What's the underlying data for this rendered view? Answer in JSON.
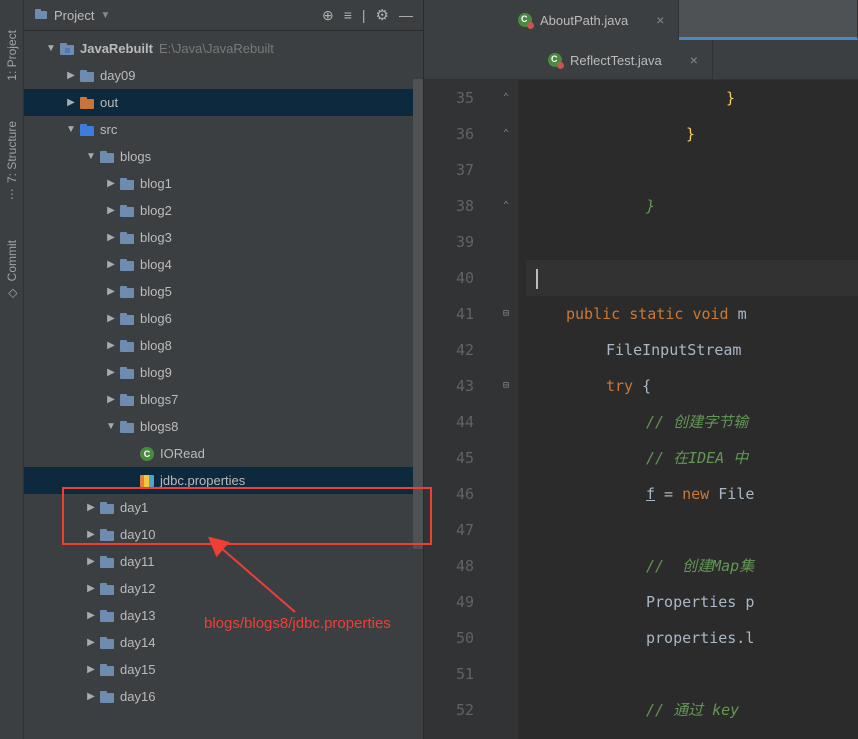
{
  "sidebar_tools": {
    "project": "1: Project",
    "structure": "7: Structure",
    "commit": "Commit"
  },
  "project_header": {
    "title": "Project"
  },
  "project_root": {
    "name": "JavaRebuilt",
    "path": "E:\\Java\\JavaRebuilt"
  },
  "tree": {
    "day09": "day09",
    "out": "out",
    "src": "src",
    "blogs": "blogs",
    "blog1": "blog1",
    "blog2": "blog2",
    "blog3": "blog3",
    "blog4": "blog4",
    "blog5": "blog5",
    "blog6": "blog6",
    "blog8": "blog8",
    "blog9": "blog9",
    "blogs7": "blogs7",
    "blogs8": "blogs8",
    "ioread": "IORead",
    "jdbc_props": "jdbc.properties",
    "day1": "day1",
    "day10": "day10",
    "day11": "day11",
    "day12": "day12",
    "day13": "day13",
    "day14": "day14",
    "day15": "day15",
    "day16": "day16"
  },
  "tabs": {
    "about_path": "AboutPath.java",
    "reflect_test": "ReflectTest.java"
  },
  "gutter": {
    "l35": "35",
    "l36": "36",
    "l37": "37",
    "l38": "38",
    "l39": "39",
    "l40": "40",
    "l41": "41",
    "l42": "42",
    "l43": "43",
    "l44": "44",
    "l45": "45",
    "l46": "46",
    "l47": "47",
    "l48": "48",
    "l49": "49",
    "l50": "50",
    "l51": "51",
    "l52": "52"
  },
  "code": {
    "l35": "}",
    "l36": "}",
    "l38": "}",
    "l41_public": "public",
    "l41_static": "static",
    "l41_void": "void",
    "l41_m": " m",
    "l42": "FileInputStream ",
    "l43_try": "try",
    "l43_brace": " {",
    "l44": "// 创建字节输",
    "l45": "// 在IDEA 中",
    "l46_f": "f",
    "l46_eq": " = ",
    "l46_new": "new",
    "l46_file": " File",
    "l48": "//  创建Map集",
    "l49": "Properties p",
    "l50": "properties.l",
    "l52": "// 通过 key "
  },
  "annotation": {
    "text": "blogs/blogs8/jdbc.properties"
  }
}
